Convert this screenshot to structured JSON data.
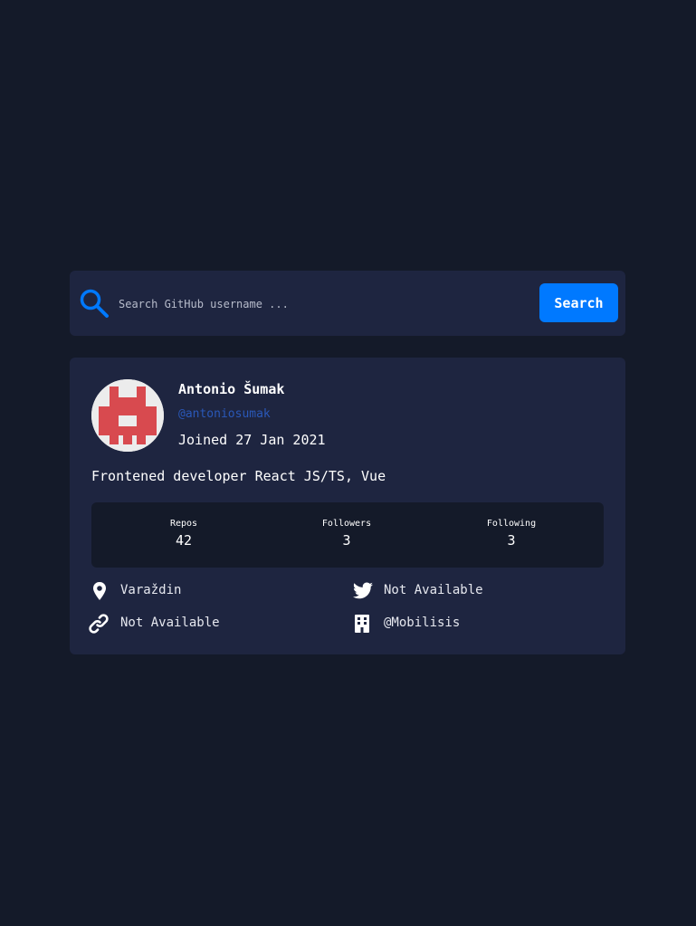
{
  "search": {
    "placeholder": "Search GitHub username ...",
    "value": "",
    "button_label": "Search"
  },
  "profile": {
    "name": "Antonio Šumak",
    "login": "@antoniosumak",
    "joined": "Joined 27 Jan 2021",
    "bio": "Frontened developer React JS/TS, Vue"
  },
  "stats": {
    "repos": {
      "label": "Repos",
      "value": "42"
    },
    "followers": {
      "label": "Followers",
      "value": "3"
    },
    "following": {
      "label": "Following",
      "value": "3"
    }
  },
  "links": {
    "location": {
      "icon": "location-pin-icon",
      "text": "Varaždin"
    },
    "twitter": {
      "icon": "twitter-icon",
      "text": "Not Available"
    },
    "website": {
      "icon": "link-icon",
      "text": "Not Available"
    },
    "company": {
      "icon": "building-icon",
      "text": "@Mobilisis"
    }
  },
  "colors": {
    "background": "#141a29",
    "card": "#1e2540",
    "accent": "#0079ff",
    "login": "#2a58b8"
  }
}
